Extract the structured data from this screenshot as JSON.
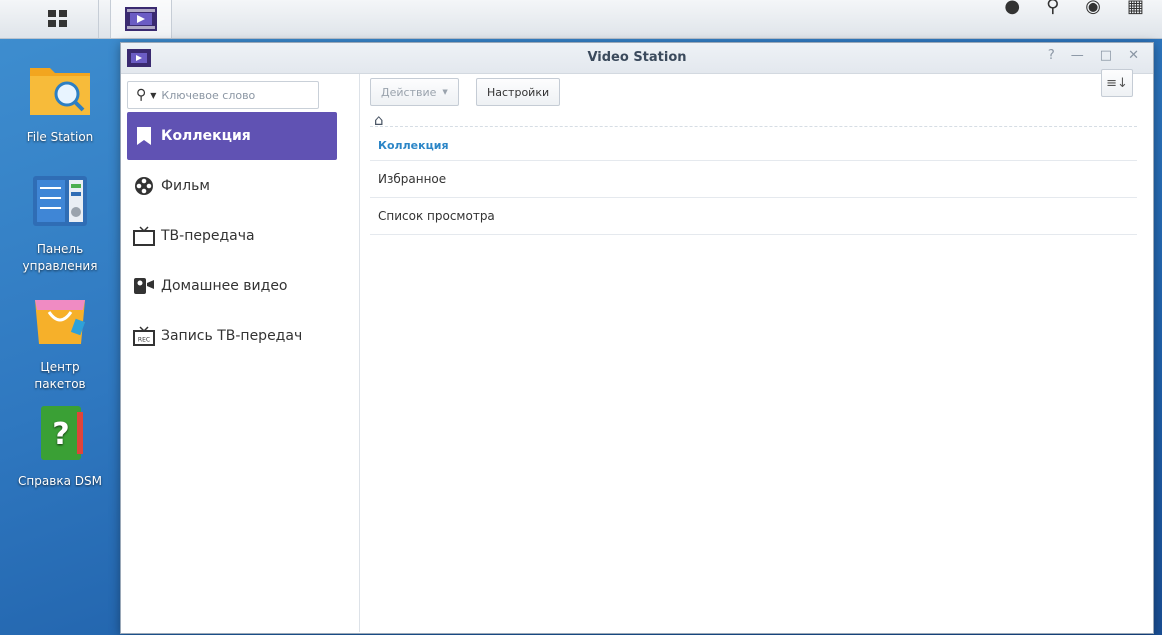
{
  "taskbar": {
    "icons": [
      "main-menu-icon",
      "video-station-icon",
      "user-icon",
      "search-icon",
      "widgets-icon",
      "windows-icon"
    ]
  },
  "desktop": {
    "items": [
      {
        "label": "File Station",
        "icon": "file-station-icon"
      },
      {
        "label": "Панель управления",
        "icon": "control-panel-icon"
      },
      {
        "label": "Центр пакетов",
        "icon": "package-center-icon"
      },
      {
        "label": "Справка DSM",
        "icon": "dsm-help-icon"
      }
    ]
  },
  "window": {
    "title": "Video Station",
    "controls": {
      "help": "?",
      "minimize": "—",
      "maximize": "□",
      "close": "✕"
    }
  },
  "sidebar": {
    "search_placeholder": "Ключевое слово",
    "items": [
      {
        "label": "Коллекция",
        "icon": "bookmark-icon",
        "active": true
      },
      {
        "label": "Фильм",
        "icon": "film-reel-icon"
      },
      {
        "label": "ТВ-передача",
        "icon": "tv-icon"
      },
      {
        "label": "Домашнее видео",
        "icon": "camcorder-icon"
      },
      {
        "label": "Запись ТВ-передач",
        "icon": "tv-record-icon"
      }
    ]
  },
  "toolbar": {
    "action_label": "Действие",
    "settings_label": "Настройки"
  },
  "list": {
    "header": "Коллекция",
    "rows": [
      "Избранное",
      "Список просмотра"
    ]
  },
  "colors": {
    "accent": "#6052b3",
    "link": "#2c86c7"
  }
}
